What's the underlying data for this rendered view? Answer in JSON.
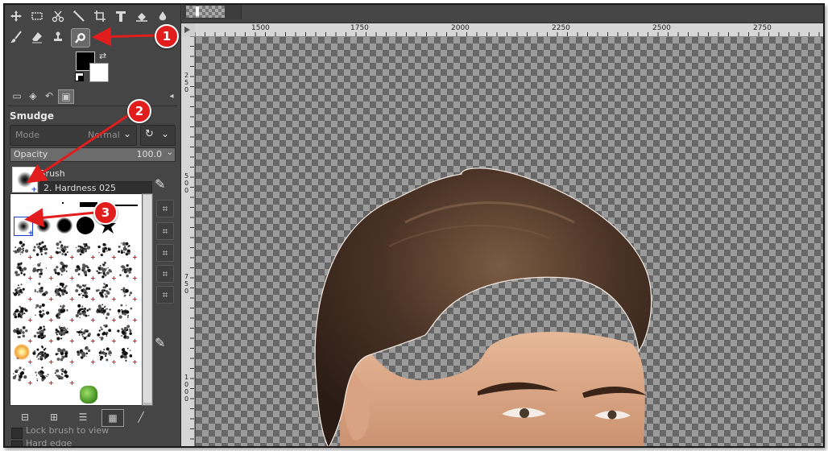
{
  "colors": {
    "accent_red": "#e21d1d",
    "panel_bg": "#454545",
    "checker_light": "#9b9b9b",
    "checker_dark": "#676767"
  },
  "tool_options": {
    "title": "Smudge",
    "mode_label": "Mode",
    "mode_value": "Normal",
    "opacity_label": "Opacity",
    "opacity_value": "100.0",
    "brush_label": "Brush",
    "brush_name": "2. Hardness 025"
  },
  "ruler": {
    "h_ticks": [
      "1500",
      "1750",
      "2000",
      "2250",
      "2500",
      "2750"
    ],
    "v_ticks": [
      "250",
      "500",
      "750",
      "1000"
    ]
  },
  "checkboxes": [
    {
      "label": "Lock brush to view"
    },
    {
      "label": "Hard edge"
    }
  ],
  "annotations": [
    {
      "number": "1"
    },
    {
      "number": "2"
    },
    {
      "number": "3"
    }
  ],
  "icons": {
    "toolbox": [
      "move-icon",
      "rect-select-icon",
      "scissors-icon",
      "fuzzy-select-icon",
      "crop-icon",
      "text-tool-icon",
      "bucket-fill-icon",
      "heal-icon",
      "paintbrush-icon",
      "eraser-icon",
      "clone-icon",
      "smudge-icon"
    ],
    "bottom": [
      "minus-icon",
      "plus-icon",
      "list-view-icon",
      "grid-view-icon",
      "edit-icon"
    ]
  }
}
